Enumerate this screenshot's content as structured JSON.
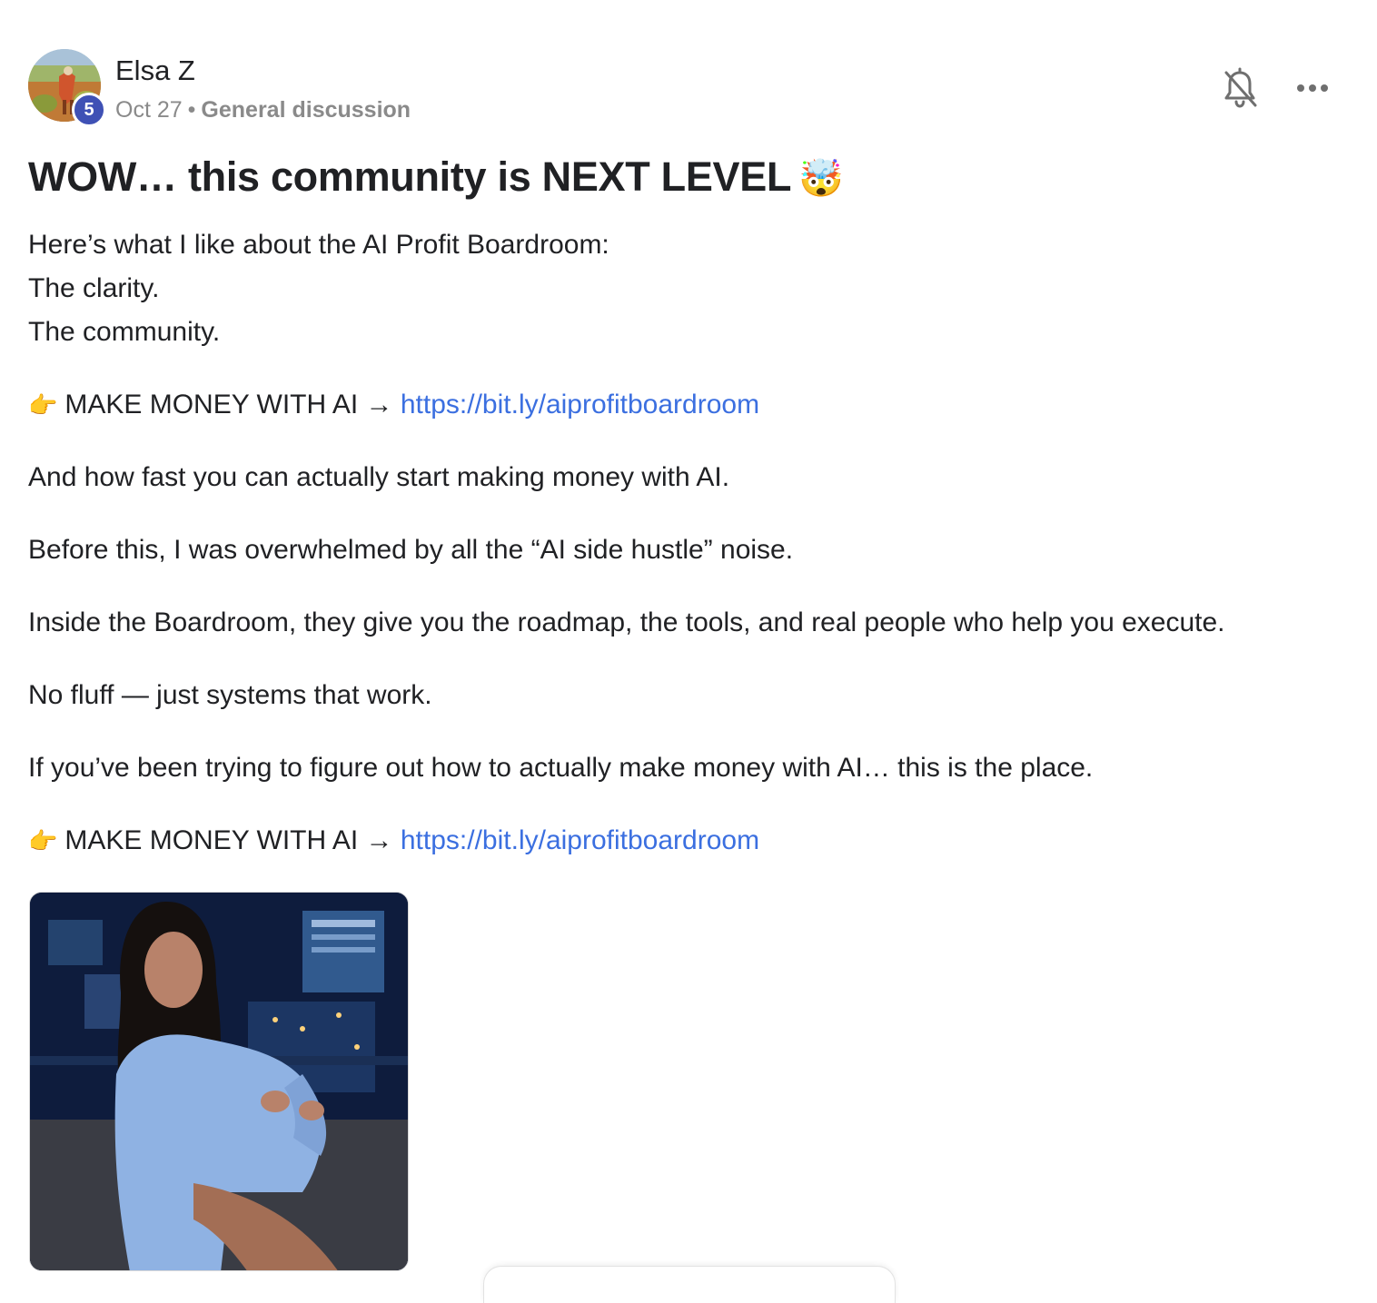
{
  "post": {
    "author": {
      "name": "Elsa Z",
      "level": "5"
    },
    "date": "Oct 27",
    "separator": "•",
    "category": "General discussion",
    "title": "WOW… this community is NEXT LEVEL",
    "title_emoji": "🤯",
    "body": {
      "intro_line1": "Here’s what I like about the AI Profit Boardroom:",
      "intro_line2": "The clarity.",
      "intro_line3": "The community.",
      "cta_hand": "👉",
      "cta_text": "MAKE MONEY WITH AI → ",
      "cta_link": "https://bit.ly/aiprofitboardroom",
      "para1": "And how fast you can actually start making money with AI.",
      "para2": "Before this, I was overwhelmed by all the “AI side hustle” noise.",
      "para3": "Inside the Boardroom, they give you the roadmap, the tools, and real people who help you execute.",
      "para4": "No fluff — just systems that work.",
      "para5": "If you’ve been trying to figure out how to actually make money with AI… this is the place."
    },
    "icons": {
      "notifications": "bell-off-icon",
      "more": "more-horizontal-icon"
    },
    "colors": {
      "link": "#3b6fe0",
      "badge": "#3f51b5",
      "meta": "#8a8a8a"
    }
  }
}
